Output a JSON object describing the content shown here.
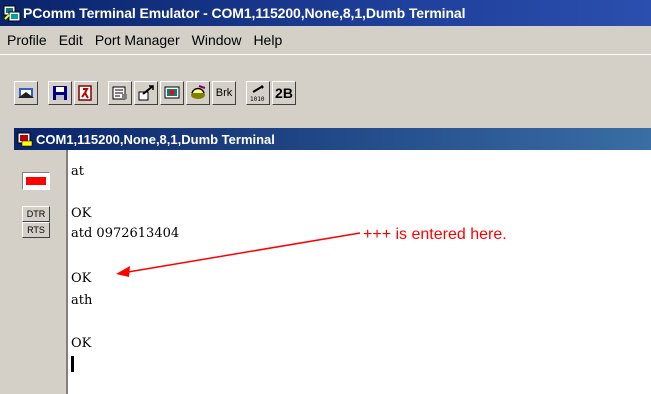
{
  "app": {
    "title": "PComm Terminal Emulator - COM1,115200,None,8,1,Dumb Terminal"
  },
  "menu": {
    "items": [
      "Profile",
      "Edit",
      "Port Manager",
      "Window",
      "Help"
    ]
  },
  "toolbar": {
    "buttons": [
      {
        "icon": "open-icon"
      },
      {
        "icon": "save-icon"
      },
      {
        "icon": "exit-icon"
      },
      {
        "icon": "properties-icon"
      },
      {
        "icon": "transfer-icon"
      },
      {
        "icon": "capture-icon"
      },
      {
        "icon": "dial-icon"
      },
      {
        "icon": "break-icon",
        "label": "Brk"
      },
      {
        "icon": "binary-icon"
      },
      {
        "icon": "mode-icon",
        "label": "2B"
      }
    ]
  },
  "terminal_window": {
    "title": "COM1,115200,None,8,1,Dumb Terminal",
    "signals": [
      "DTR",
      "RTS"
    ],
    "led_color": "#ff0000",
    "lines": [
      "at",
      "",
      "OK",
      "atd 0972613404",
      "",
      "OK",
      "ath",
      "",
      "OK"
    ]
  },
  "annotation": {
    "text": "+++ is entered here.",
    "color": "#ff0000"
  }
}
